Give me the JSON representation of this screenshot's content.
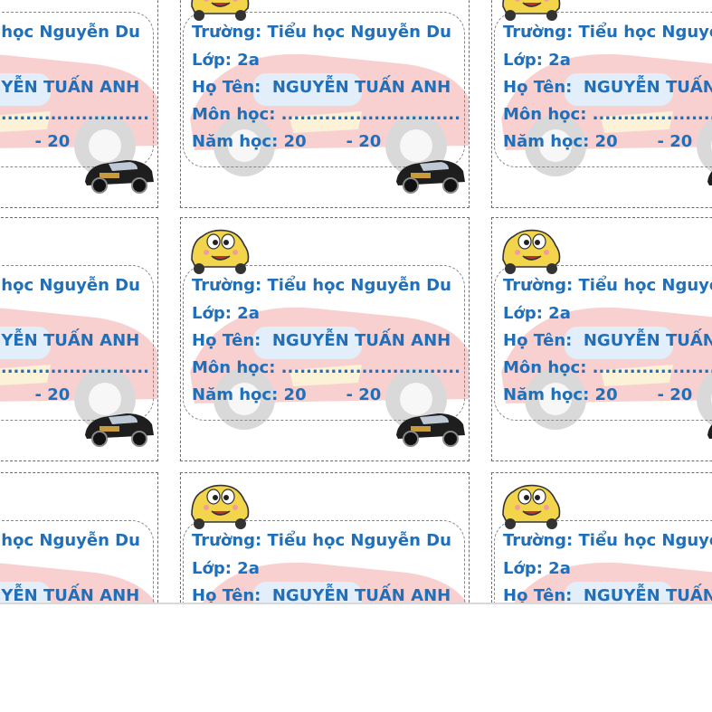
{
  "label": {
    "school_line": "Trường: Tiểu học Nguyễn Du",
    "class_line": "Lớp: 2a",
    "name_line": "Họ Tên:  NGUYỄN TUẤN ANH",
    "subject_line": "Môn học: .............................",
    "year_line": "Năm học: 20       - 20"
  },
  "icons": {
    "top_left": "yellow-cartoon-car-icon",
    "bottom_right": "black-race-car-icon",
    "background": "red-race-car-watermark"
  },
  "colors": {
    "text": "#1f6fba",
    "border": "#6d6d6d",
    "yellow_car": "#f2d54a",
    "black_car": "#1e1e1e",
    "watermark_red": "#e53030"
  }
}
